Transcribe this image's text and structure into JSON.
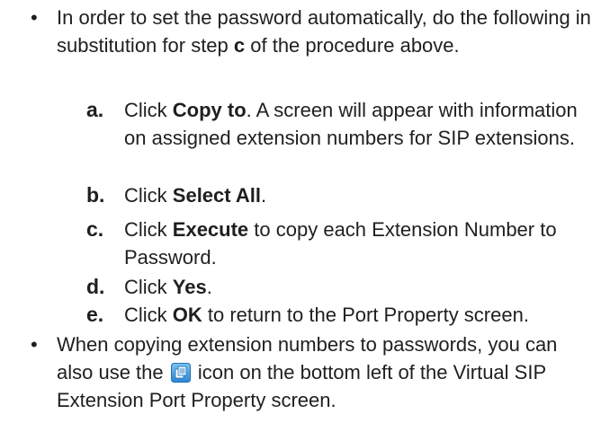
{
  "bullet1": {
    "marker": "•",
    "text_before": "In order to set the password automatically, do the following in substitution for step ",
    "step_ref": "c",
    "text_after": " of the procedure above."
  },
  "steps": [
    {
      "letter": "a.",
      "pre": "Click ",
      "bold": "Copy to",
      "post": ". A screen will appear with information on assigned extension numbers for SIP extensions."
    },
    {
      "letter": "b.",
      "pre": "Click ",
      "bold": "Select All",
      "post": "."
    },
    {
      "letter": "c.",
      "pre": "Click ",
      "bold": "Execute",
      "post": " to copy each Extension Number to Password."
    },
    {
      "letter": "d.",
      "pre": "Click ",
      "bold": "Yes",
      "post": "."
    },
    {
      "letter": "e.",
      "pre": "Click ",
      "bold": "OK",
      "post": " to return to the Port Property screen."
    }
  ],
  "bullet2": {
    "marker": "•",
    "text_before": "When copying extension numbers to passwords, you can also use the ",
    "icon_name": "copy-extension-icon",
    "text_after": " icon on the bottom left of the Virtual SIP Extension Port Property screen."
  }
}
